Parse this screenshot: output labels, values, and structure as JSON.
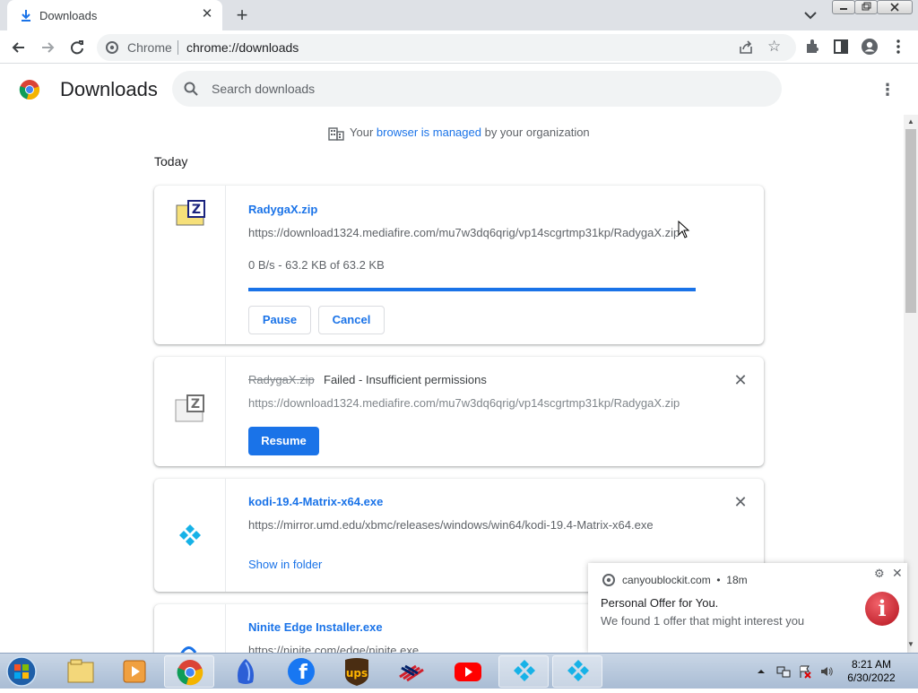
{
  "tab": {
    "title": "Downloads"
  },
  "omnibox": {
    "site": "Chrome",
    "url": "chrome://downloads"
  },
  "header": {
    "title": "Downloads",
    "search_placeholder": "Search downloads"
  },
  "managed": {
    "prefix": "Your",
    "link": "browser is managed",
    "suffix": "by your organization"
  },
  "section": {
    "today": "Today"
  },
  "downloads": [
    {
      "filename": "RadygaX.zip",
      "url": "https://download1324.mediafire.com/mu7w3dq6qrig/vp14scgrtmp31kp/RadygaX.zip",
      "status": "0 B/s - 63.2 KB of 63.2 KB",
      "progress_percent": 100,
      "buttons": [
        "Pause",
        "Cancel"
      ]
    },
    {
      "filename": "RadygaX.zip",
      "status": "Failed - Insufficient permissions",
      "url": "https://download1324.mediafire.com/mu7w3dq6qrig/vp14scgrtmp31kp/RadygaX.zip",
      "button": "Resume"
    },
    {
      "filename": "kodi-19.4-Matrix-x64.exe",
      "url": "https://mirror.umd.edu/xbmc/releases/windows/win64/kodi-19.4-Matrix-x64.exe",
      "link": "Show in folder"
    },
    {
      "filename": "Ninite Edge Installer.exe",
      "url": "https://ninite.com/edge/ninite.exe"
    }
  ],
  "notification": {
    "source": "canyoublockit.com",
    "time": "18m",
    "title": "Personal Offer for You.",
    "body": "We found 1 offer that might interest you"
  },
  "taskbar": {
    "time": "8:21 AM",
    "date": "6/30/2022",
    "apps": [
      "explorer-icon",
      "media-player-icon",
      "chrome-icon",
      "browser-icon",
      "facebook-icon",
      "ups-icon",
      "bank-icon",
      "youtube-icon",
      "kodi-icon",
      "kodi-icon"
    ]
  },
  "colors": {
    "accent": "#1a73e8",
    "tabstrip": "#dee1e6",
    "omnibox": "#f1f3f4"
  }
}
